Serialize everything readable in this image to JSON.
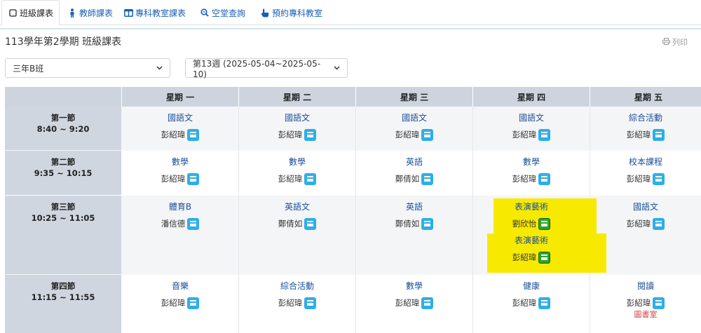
{
  "tabs": [
    {
      "label": "班級課表",
      "icon": "square-icon"
    },
    {
      "label": "教師課表",
      "icon": "person-icon"
    },
    {
      "label": "專科教室課表",
      "icon": "columns-icon"
    },
    {
      "label": "空堂查詢",
      "icon": "search-icon"
    },
    {
      "label": "預約專科教室",
      "icon": "hand-pointer-icon"
    }
  ],
  "page_title": "113學年第2學期 班級課表",
  "print_label": "列印",
  "class_select": "三年B班",
  "week_select": "第13週 (2025-05-04~2025-05-10)",
  "days": [
    "星期 一",
    "星期 二",
    "星期 三",
    "星期 四",
    "星期 五"
  ],
  "periods": [
    {
      "name": "第一節",
      "time": "8:40 ~ 9:20"
    },
    {
      "name": "第二節",
      "time": "9:35 ~ 10:15"
    },
    {
      "name": "第三節",
      "time": "10:25 ~ 11:05"
    },
    {
      "name": "第四節",
      "time": "11:15 ~ 11:55"
    }
  ],
  "schedule": [
    [
      {
        "subject": "國語文",
        "teacher": "彭紹瑋"
      },
      {
        "subject": "國語文",
        "teacher": "彭紹瑋"
      },
      {
        "subject": "國語文",
        "teacher": "彭紹瑋"
      },
      {
        "subject": "國語文",
        "teacher": "彭紹瑋"
      },
      {
        "subject": "綜合活動",
        "teacher": "彭紹瑋"
      }
    ],
    [
      {
        "subject": "數學",
        "teacher": "彭紹瑋"
      },
      {
        "subject": "數學",
        "teacher": "彭紹瑋"
      },
      {
        "subject": "英語",
        "teacher": "鄭倩如"
      },
      {
        "subject": "數學",
        "teacher": "彭紹瑋"
      },
      {
        "subject": "校本課程",
        "teacher": "彭紹瑋"
      }
    ],
    [
      {
        "subject": "體育B",
        "teacher": "潘信德"
      },
      {
        "subject": "英語文",
        "teacher": "鄭倩如"
      },
      {
        "subject": "英語",
        "teacher": "鄭倩如"
      },
      {
        "subject": "表演藝術",
        "teacher": "劉欣怡",
        "subject2": "表演藝術",
        "teacher2": "彭紹瑋"
      },
      {
        "subject": "國語文",
        "teacher": "彭紹瑋"
      }
    ],
    [
      {
        "subject": "音樂",
        "teacher": "彭紹瑋"
      },
      {
        "subject": "綜合活動",
        "teacher": "彭紹瑋"
      },
      {
        "subject": "數學",
        "teacher": "彭紹瑋"
      },
      {
        "subject": "健康",
        "teacher": "彭紹瑋"
      },
      {
        "subject": "閱讀",
        "teacher": "彭紹瑋",
        "room": "圖書室"
      }
    ]
  ],
  "colors": {
    "accent": "#1a5fb4",
    "calendar_button": "#2eaee8",
    "highlight": "#f7ea00",
    "room_text": "#d04040"
  }
}
